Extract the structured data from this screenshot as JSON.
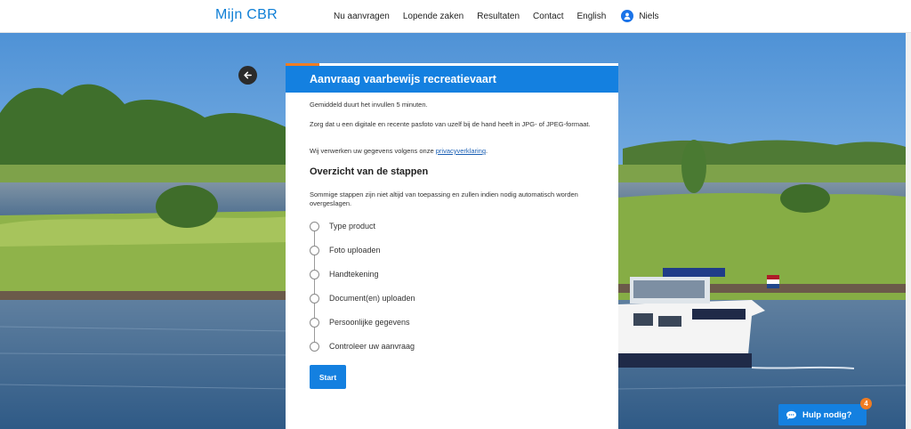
{
  "header": {
    "logo": "Mijn CBR",
    "nav": [
      "Nu aanvragen",
      "Lopende zaken",
      "Resultaten",
      "Contact",
      "English"
    ],
    "user_name": "Niels"
  },
  "card": {
    "title": "Aanvraag vaarbewijs recreatievaart",
    "intro_duration": "Gemiddeld duurt het invullen 5 minuten.",
    "intro_photo": "Zorg dat u een digitale en recente pasfoto van uzelf bij de hand heeft in JPG- of JPEG-formaat.",
    "privacy_prefix": "Wij verwerken uw gegevens volgens onze ",
    "privacy_link": "privacyverklaring",
    "privacy_suffix": ".",
    "steps_title": "Overzicht van de stappen",
    "steps_note": "Sommige stappen zijn niet altijd van toepassing en zullen indien nodig automatisch worden overgeslagen.",
    "steps": [
      "Type product",
      "Foto uploaden",
      "Handtekening",
      "Document(en) uploaden",
      "Persoonlijke gegevens",
      "Controleer uw aanvraag"
    ],
    "start_label": "Start"
  },
  "help": {
    "label": "Hulp nodig?",
    "badge": "4"
  },
  "colors": {
    "primary": "#1480e0",
    "accent": "#f07c22"
  },
  "icons": {
    "back": "arrow-left-icon",
    "user": "user-icon",
    "help": "chat-icon"
  }
}
